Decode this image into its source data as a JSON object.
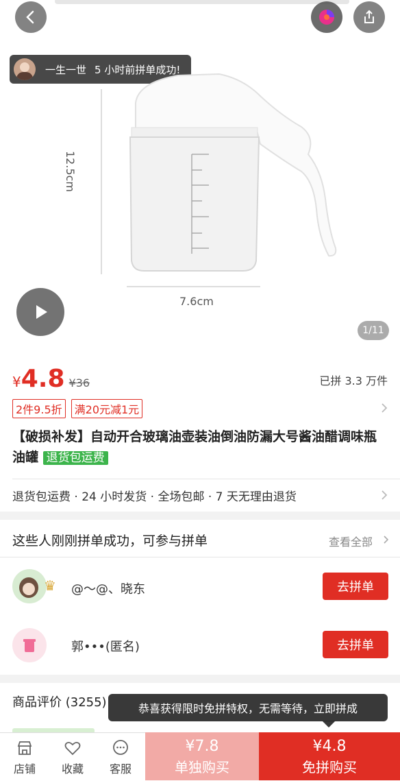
{
  "toast": {
    "user": "一生一世",
    "message": "5 小时前拼单成功!"
  },
  "image": {
    "height_label": "12.5cm",
    "width_label": "7.6cm",
    "counter": "1/11"
  },
  "price": {
    "symbol": "¥",
    "current": "4.8",
    "original": "¥36",
    "sold": "已拼 3.3 万件"
  },
  "tags": [
    "2件9.5折",
    "满20元减1元"
  ],
  "product": {
    "title": "【破损补发】自动开合玻璃油壶装油倒油防漏大号酱油醋调味瓶油罐",
    "badge": "退货包运费"
  },
  "services": "退货包运费 · 24 小时发货 · 全场包邮 · 7 天无理由退货",
  "group": {
    "heading": "这些人刚刚拼单成功，可参与拼单",
    "view_all": "查看全部",
    "rows": [
      {
        "name": "@～@、晓东",
        "button": "去拼单"
      },
      {
        "name": "郭•••(匿名)",
        "button": "去拼单"
      }
    ]
  },
  "reviews": {
    "heading": "商品评价 (3255)"
  },
  "bubble": "恭喜获得限时免拼特权，无需等待，立即拼成",
  "bottom_nav": [
    {
      "label": "店铺",
      "icon": "store-icon"
    },
    {
      "label": "收藏",
      "icon": "heart-icon"
    },
    {
      "label": "客服",
      "icon": "chat-icon"
    }
  ],
  "buy_single": {
    "price": "¥7.8",
    "label": "单独购买"
  },
  "buy_group": {
    "price": "¥4.8",
    "label": "免拼购买"
  },
  "colors": {
    "accent": "#e02e24",
    "accent_light": "#f2aaa6",
    "green": "#3cb44b"
  }
}
